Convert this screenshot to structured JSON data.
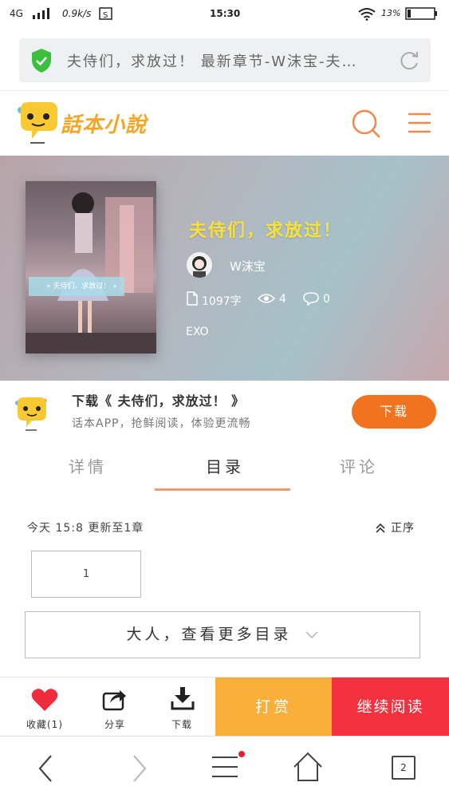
{
  "status_bar": {
    "network": "4G",
    "speed": "0.9k/s",
    "time": "15:30",
    "battery": "13%"
  },
  "url_bar": {
    "url_text": "夫侍们，求放过！ 最新章节-W沫宝-夫…"
  },
  "header": {
    "logo_text": "話本小說"
  },
  "book": {
    "title": "夫侍们，求放过！",
    "author": "W沫宝",
    "word_count": "1097字",
    "views": "4",
    "comments": "0",
    "tag": "EXO",
    "cover_caption": "« 夫侍们，求放过！ »"
  },
  "banner": {
    "title": "下载《 夫侍们，求放过！ 》",
    "subtitle": "话本APP，抢鲜阅读，体验更流畅",
    "button_label": "下载"
  },
  "tabs": [
    {
      "label": "详情"
    },
    {
      "label": "目录"
    },
    {
      "label": "评论"
    }
  ],
  "catalog": {
    "update_text": "今天 15:8 更新至1章",
    "sort_label": "正序",
    "chapters": [
      "1"
    ],
    "more_label": "大人，查看更多目录"
  },
  "action_bar": {
    "collect_label": "收藏(1)",
    "share_label": "分享",
    "download_label": "下载",
    "tip_label": "打赏",
    "read_label": "继续阅读"
  },
  "browser_nav": {
    "tab_count": "2"
  },
  "colors": {
    "accent_orange": "#f2731f",
    "tip_yellow": "#fbaf3b",
    "read_red": "#f4313f",
    "title_yellow": "#f7e23a",
    "logo_yellow": "#f5a524",
    "tab_indicator": "#f19a6d"
  }
}
